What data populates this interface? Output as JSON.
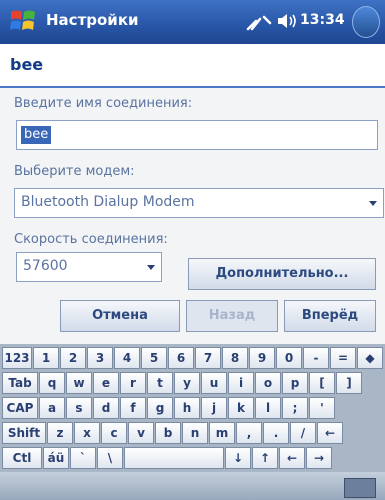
{
  "titlebar": {
    "title": "Настройки",
    "time": "13:34"
  },
  "connection_name": "bee",
  "form": {
    "name_label": "Введите имя соединения:",
    "name_value": "bee",
    "modem_label": "Выберите модем:",
    "modem_value": "Bluetooth Dialup Modem",
    "speed_label": "Скорость соединения:",
    "speed_value": "57600",
    "advanced_label": "Дополнительно..."
  },
  "buttons": {
    "cancel": "Отмена",
    "back": "Назад",
    "next": "Вперёд"
  },
  "keyboard": {
    "rows": [
      [
        "123",
        "1",
        "2",
        "3",
        "4",
        "5",
        "6",
        "7",
        "8",
        "9",
        "0",
        "-",
        "=",
        "◆"
      ],
      [
        "Tab",
        "q",
        "w",
        "e",
        "r",
        "t",
        "y",
        "u",
        "i",
        "o",
        "p",
        "[",
        "]"
      ],
      [
        "CAP",
        "a",
        "s",
        "d",
        "f",
        "g",
        "h",
        "j",
        "k",
        "l",
        ";",
        "'"
      ],
      [
        "Shift",
        "z",
        "x",
        "c",
        "v",
        "b",
        "n",
        "m",
        ",",
        ".",
        "/",
        "←"
      ],
      [
        "Ctl",
        "áü",
        "`",
        "\\",
        "",
        "↓",
        "↑",
        "←",
        "→"
      ]
    ]
  }
}
